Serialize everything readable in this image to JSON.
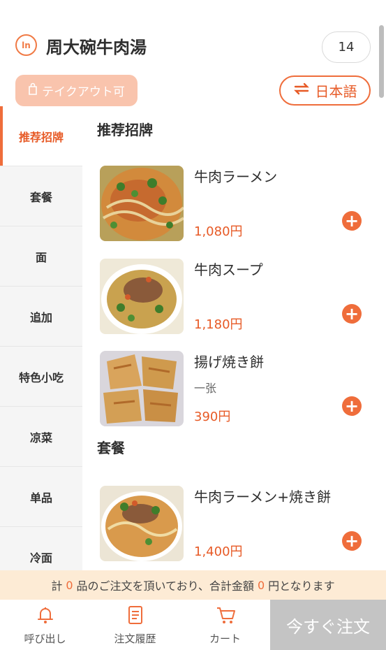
{
  "header": {
    "logo_text": "ln",
    "store_name": "周大碗牛肉湯",
    "table_number": "14",
    "takeout_label": "テイクアウト可",
    "language_label": "日本語"
  },
  "sidebar": {
    "items": [
      {
        "label": "推荐招牌"
      },
      {
        "label": "套餐"
      },
      {
        "label": "面"
      },
      {
        "label": "追加"
      },
      {
        "label": "特色小吃"
      },
      {
        "label": "凉菜"
      },
      {
        "label": "单品"
      },
      {
        "label": "冷面"
      }
    ]
  },
  "menu": {
    "sections": [
      {
        "title": "推荐招牌",
        "items": [
          {
            "name": "牛肉ラーメン",
            "subtitle": "",
            "price": "1,080円"
          },
          {
            "name": "牛肉スープ",
            "subtitle": "",
            "price": "1,180円"
          },
          {
            "name": "揚げ焼き餅",
            "subtitle": "一张",
            "price": "390円"
          }
        ]
      },
      {
        "title": "套餐",
        "items": [
          {
            "name": "牛肉ラーメン+焼き餅",
            "subtitle": "",
            "price": "1,400円"
          }
        ]
      }
    ]
  },
  "summary": {
    "prefix": "計",
    "count": "0",
    "middle": "品のご注文を頂いており、合計金額",
    "total": "0",
    "suffix": "円となります"
  },
  "bottom_nav": {
    "call_label": "呼び出し",
    "history_label": "注文履歴",
    "cart_label": "カート",
    "order_label": "今すぐ注文"
  },
  "colors": {
    "accent": "#ef6d3b",
    "price": "#e75a26",
    "takeout_bg": "#f9c4ad",
    "summary_bg": "#fdebd5",
    "order_button_bg": "#c4c4c4"
  }
}
